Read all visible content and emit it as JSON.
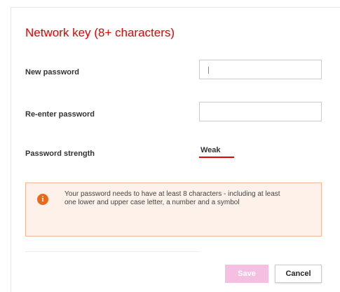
{
  "dialog": {
    "title": "Network key (8+ characters)",
    "new_password_label": "New password",
    "new_password_value": "",
    "reenter_password_label": "Re-enter password",
    "reenter_password_value": "",
    "strength_label": "Password strength",
    "strength_value": "Weak",
    "strength_level": 0.25,
    "notice_icon": "info-icon",
    "notice_text": "Your password needs to have at least 8 characters - including at least one lower and upper case letter, a number and a symbol",
    "save_label": "Save",
    "cancel_label": "Cancel"
  },
  "colors": {
    "accent": "#e60000",
    "warning": "#eb6a1a",
    "notice_bg": "#fdf1ea",
    "save_disabled": "#f4bfe0"
  }
}
